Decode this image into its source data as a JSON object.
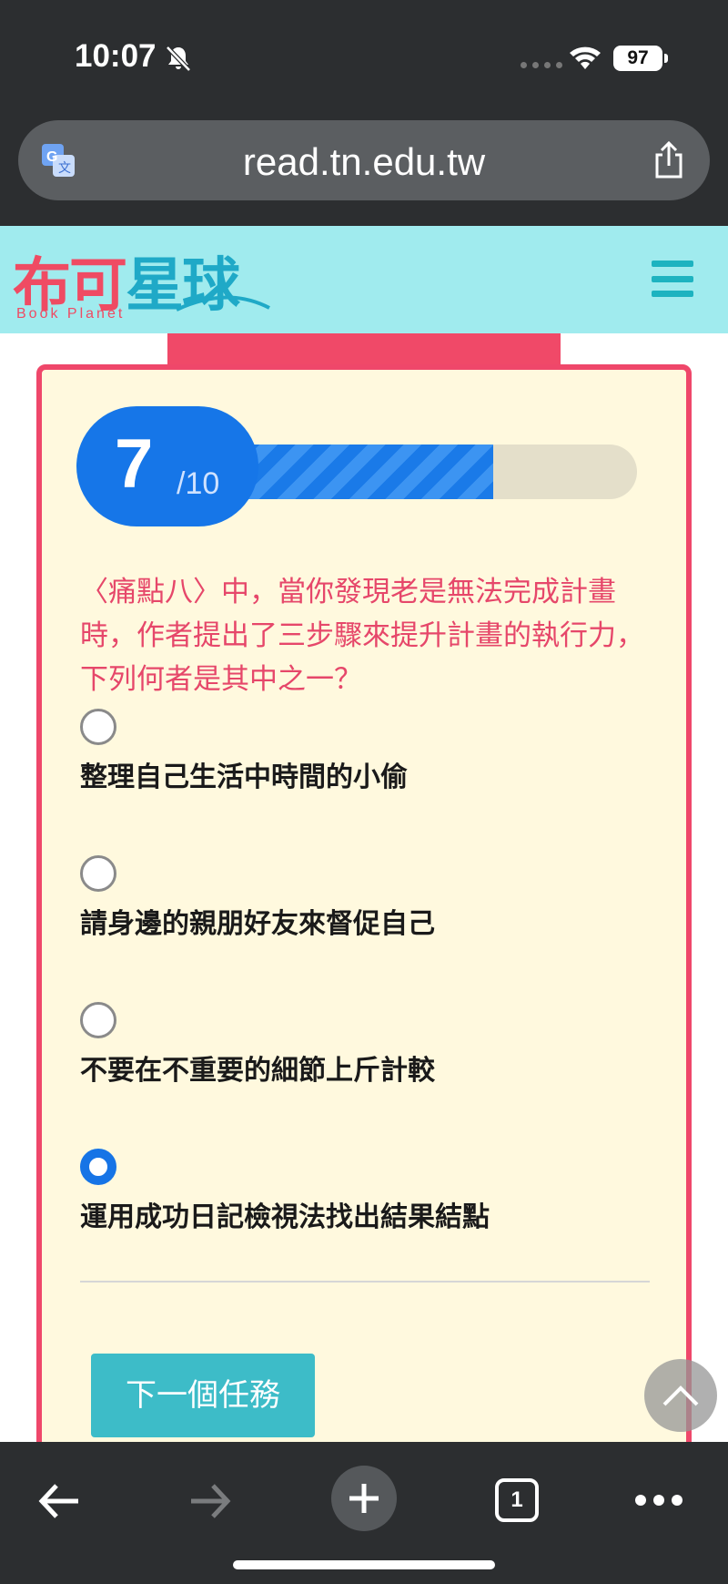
{
  "status_bar": {
    "time": "10:07",
    "battery": "97"
  },
  "url_bar": {
    "url": "read.tn.edu.tw"
  },
  "site": {
    "logo_main_a": "布可",
    "logo_main_b": "星球",
    "logo_sub": "Book Planet"
  },
  "quiz": {
    "progress": {
      "current": "7",
      "total": "/10",
      "fraction": 0.7
    },
    "question": "〈痛點八〉中，當你發現老是無法完成計畫時，作者提出了三步驟來提升計畫的執行力，下列何者是其中之一？",
    "options": [
      {
        "label": "整理自己生活中時間的小偷",
        "selected": false
      },
      {
        "label": "請身邊的親朋好友來督促自己",
        "selected": false
      },
      {
        "label": "不要在不重要的細節上斤計較",
        "selected": false
      },
      {
        "label": "運用成功日記檢視法找出結果結點",
        "selected": true
      }
    ],
    "next_button": "下一個任務"
  },
  "toolbar": {
    "tab_count": "1"
  },
  "colors": {
    "accent_pink": "#ef476a",
    "accent_blue": "#1676e8",
    "header_cyan": "#a0ebee",
    "button_teal": "#3dbcc8"
  },
  "icons": [
    "bell-slash-icon",
    "wifi-icon",
    "translate-icon",
    "share-icon",
    "menu-icon",
    "chevron-up-icon",
    "back-arrow-icon",
    "forward-arrow-icon",
    "plus-icon",
    "tabs-icon",
    "more-icon"
  ]
}
